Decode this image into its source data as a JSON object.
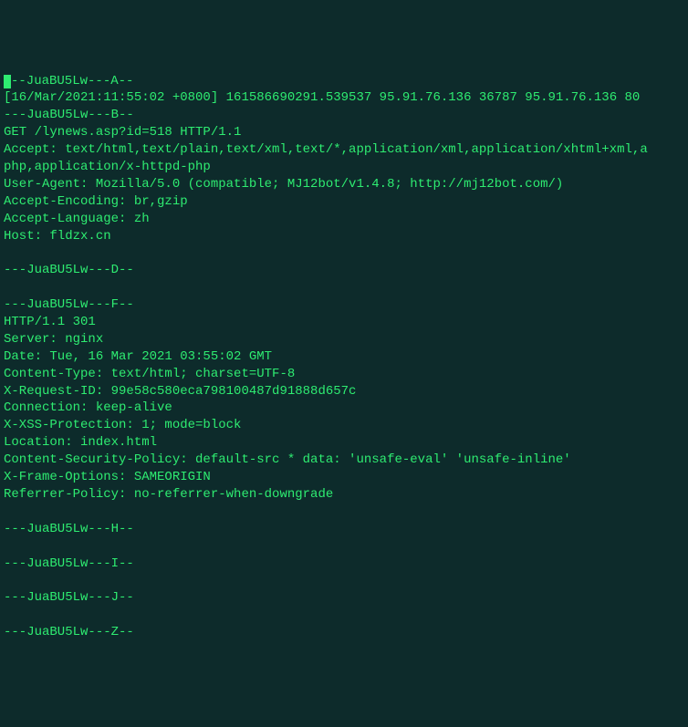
{
  "lines": [
    {
      "prefix_cursor": true,
      "text": "--JuaBU5Lw---A--"
    },
    {
      "text": "[16/Mar/2021:11:55:02 +0800] 161586690291.539537 95.91.76.136 36787 95.91.76.136 80"
    },
    {
      "text": "---JuaBU5Lw---B--"
    },
    {
      "text": "GET /lynews.asp?id=518 HTTP/1.1"
    },
    {
      "text": "Accept: text/html,text/plain,text/xml,text/*,application/xml,application/xhtml+xml,a"
    },
    {
      "text": "php,application/x-httpd-php"
    },
    {
      "text": "User-Agent: Mozilla/5.0 (compatible; MJ12bot/v1.4.8; http://mj12bot.com/)"
    },
    {
      "text": "Accept-Encoding: br,gzip"
    },
    {
      "text": "Accept-Language: zh"
    },
    {
      "text": "Host: fldzx.cn"
    },
    {
      "text": ""
    },
    {
      "text": "---JuaBU5Lw---D--"
    },
    {
      "text": ""
    },
    {
      "text": "---JuaBU5Lw---F--"
    },
    {
      "text": "HTTP/1.1 301"
    },
    {
      "text": "Server: nginx"
    },
    {
      "text": "Date: Tue, 16 Mar 2021 03:55:02 GMT"
    },
    {
      "text": "Content-Type: text/html; charset=UTF-8"
    },
    {
      "text": "X-Request-ID: 99e58c580eca798100487d91888d657c"
    },
    {
      "text": "Connection: keep-alive"
    },
    {
      "text": "X-XSS-Protection: 1; mode=block"
    },
    {
      "text": "Location: index.html"
    },
    {
      "text": "Content-Security-Policy: default-src * data: 'unsafe-eval' 'unsafe-inline'"
    },
    {
      "text": "X-Frame-Options: SAMEORIGIN"
    },
    {
      "text": "Referrer-Policy: no-referrer-when-downgrade"
    },
    {
      "text": ""
    },
    {
      "text": "---JuaBU5Lw---H--"
    },
    {
      "text": ""
    },
    {
      "text": "---JuaBU5Lw---I--"
    },
    {
      "text": ""
    },
    {
      "text": "---JuaBU5Lw---J--"
    },
    {
      "text": ""
    },
    {
      "text": "---JuaBU5Lw---Z--"
    }
  ]
}
